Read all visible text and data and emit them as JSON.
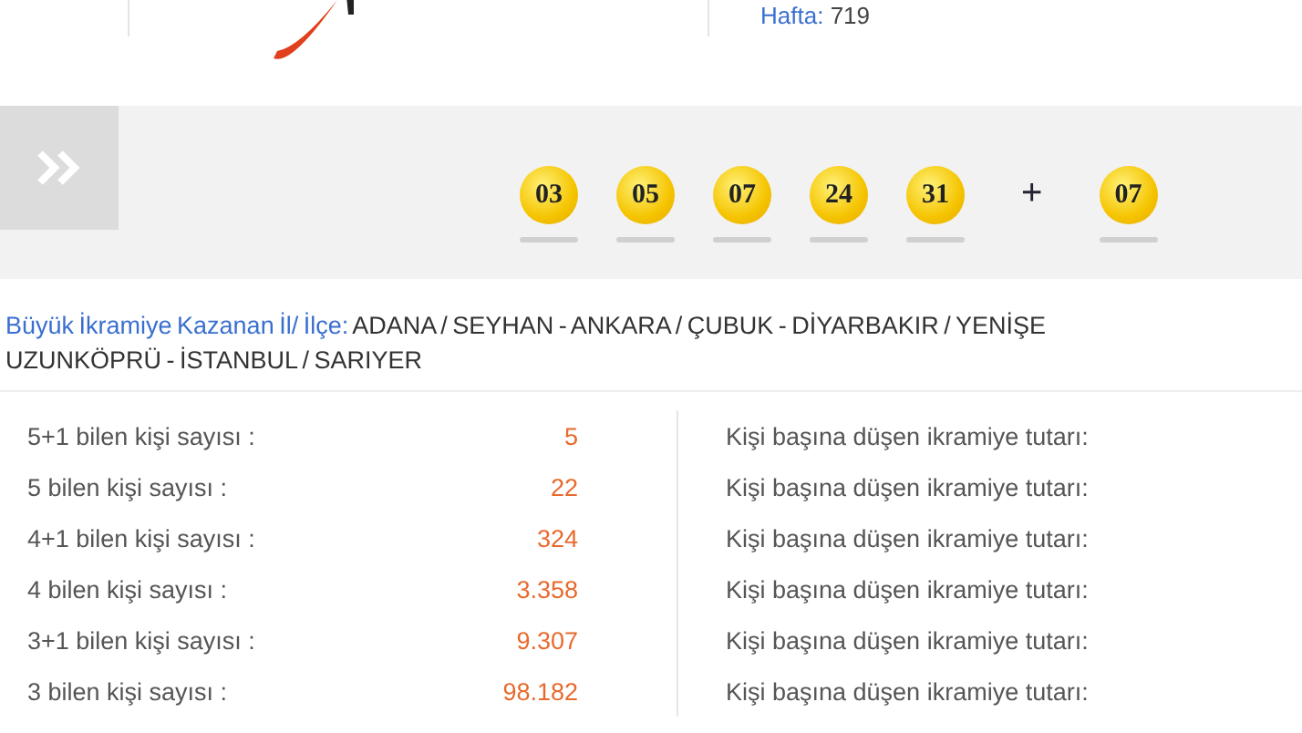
{
  "header": {
    "week_label": "Hafta:",
    "week_number": "719"
  },
  "draw": {
    "main_numbers": [
      "03",
      "05",
      "07",
      "24",
      "31"
    ],
    "plus_sign": "+",
    "bonus_number": "07"
  },
  "winners": {
    "label": "Büyük İkramiye Kazanan İl/ İlçe:",
    "text": "ADANA / SEYHAN - ANKARA / ÇUBUK - DİYARBAKIR / YENİŞE",
    "text_continued": "UZUNKÖPRÜ - İSTANBUL / SARIYER"
  },
  "results": [
    {
      "label": "5+1 bilen kişi sayısı :",
      "count": "5",
      "prize_label": "Kişi başına düşen ikramiye tutarı:"
    },
    {
      "label": "5 bilen kişi sayısı :",
      "count": "22",
      "prize_label": "Kişi başına düşen ikramiye tutarı:"
    },
    {
      "label": "4+1 bilen kişi sayısı :",
      "count": "324",
      "prize_label": "Kişi başına düşen ikramiye tutarı:"
    },
    {
      "label": "4 bilen kişi sayısı :",
      "count": "3.358",
      "prize_label": "Kişi başına düşen ikramiye tutarı:"
    },
    {
      "label": "3+1 bilen kişi sayısı :",
      "count": "9.307",
      "prize_label": "Kişi başına düşen ikramiye tutarı:"
    },
    {
      "label": "3 bilen kişi sayısı :",
      "count": "98.182",
      "prize_label": "Kişi başına düşen ikramiye tutarı:"
    }
  ]
}
